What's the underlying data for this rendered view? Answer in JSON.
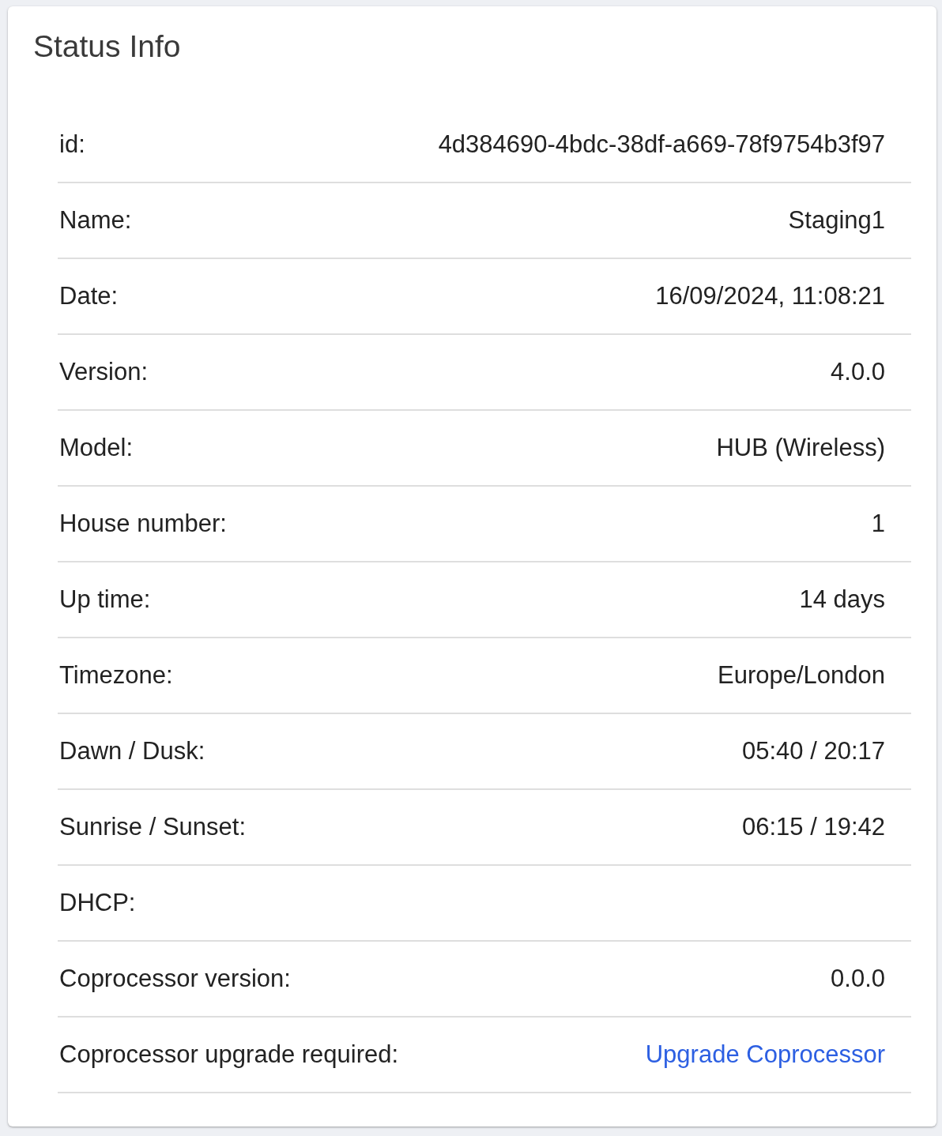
{
  "card": {
    "title": "Status Info",
    "rows": [
      {
        "label": "id:",
        "kind": "text",
        "value": "4d384690-4bdc-38df-a669-78f9754b3f97"
      },
      {
        "label": "Name:",
        "kind": "text",
        "value": "Staging1"
      },
      {
        "label": "Date:",
        "kind": "text",
        "value": "16/09/2024, 11:08:21"
      },
      {
        "label": "Version:",
        "kind": "text",
        "value": "4.0.0"
      },
      {
        "label": "Model:",
        "kind": "text",
        "value": "HUB (Wireless)"
      },
      {
        "label": "House number:",
        "kind": "text",
        "value": "1"
      },
      {
        "label": "Up time:",
        "kind": "text",
        "value": "14 days"
      },
      {
        "label": "Timezone:",
        "kind": "text",
        "value": "Europe/London"
      },
      {
        "label": "Dawn / Dusk:",
        "kind": "text",
        "value": "05:40 / 20:17"
      },
      {
        "label": "Sunrise / Sunset:",
        "kind": "text",
        "value": "06:15 / 19:42"
      },
      {
        "label": "DHCP:"
      },
      {
        "label": "Coprocessor version:",
        "kind": "text",
        "value": "0.0.0"
      },
      {
        "label": "Coprocessor upgrade required:",
        "kind": "link",
        "value": "Upgrade Coprocessor"
      }
    ]
  }
}
